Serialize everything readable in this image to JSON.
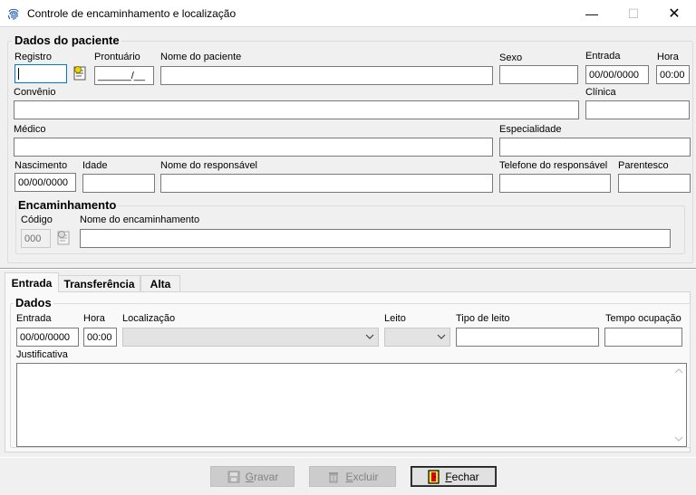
{
  "window": {
    "title": "Controle de encaminhamento e localização",
    "minimize": "—",
    "maximize": "☐",
    "close": "✕"
  },
  "patient": {
    "group_title": "Dados do paciente",
    "registro_label": "Registro",
    "registro_value": "",
    "prontuario_label": "Prontuário",
    "prontuario_value": "______/__",
    "nome_label": "Nome do paciente",
    "nome_value": "",
    "sexo_label": "Sexo",
    "sexo_value": "",
    "entrada_label": "Entrada",
    "entrada_value": "00/00/0000",
    "hora_label": "Hora",
    "hora_value": "00:00",
    "convenio_label": "Convênio",
    "convenio_value": "",
    "clinica_label": "Clínica",
    "clinica_value": "",
    "medico_label": "Médico",
    "medico_value": "",
    "especialidade_label": "Especialidade",
    "especialidade_value": "",
    "nascimento_label": "Nascimento",
    "nascimento_value": "00/00/0000",
    "idade_label": "Idade",
    "idade_value": "",
    "responsavel_label": "Nome do responsável",
    "responsavel_value": "",
    "telefone_label": "Telefone do responsável",
    "telefone_value": "",
    "parentesco_label": "Parentesco",
    "parentesco_value": ""
  },
  "referral": {
    "group_title": "Encaminhamento",
    "codigo_label": "Código",
    "codigo_value": "000",
    "nome_label": "Nome do encaminhamento",
    "nome_value": ""
  },
  "tabs": [
    {
      "label": "Entrada"
    },
    {
      "label": "Transferência"
    },
    {
      "label": "Alta"
    }
  ],
  "entry": {
    "group_title": "Dados",
    "entrada_label": "Entrada",
    "entrada_value": "00/00/0000",
    "hora_label": "Hora",
    "hora_value": "00:00",
    "localizacao_label": "Localização",
    "localizacao_value": "",
    "leito_label": "Leito",
    "leito_value": "",
    "tipo_leito_label": "Tipo de leito",
    "tipo_leito_value": "",
    "tempo_label": "Tempo ocupação",
    "tempo_value": "",
    "justificativa_label": "Justificativa",
    "justificativa_value": ""
  },
  "buttons": {
    "gravar_first": "G",
    "gravar_rest": "ravar",
    "excluir_first": "E",
    "excluir_rest": "xcluir",
    "fechar_first": "F",
    "fechar_rest": "echar"
  },
  "colors": {
    "accent": "#0078d7",
    "window_bg": "#f0f0f0",
    "fechar_icon": "#f5e23b"
  }
}
